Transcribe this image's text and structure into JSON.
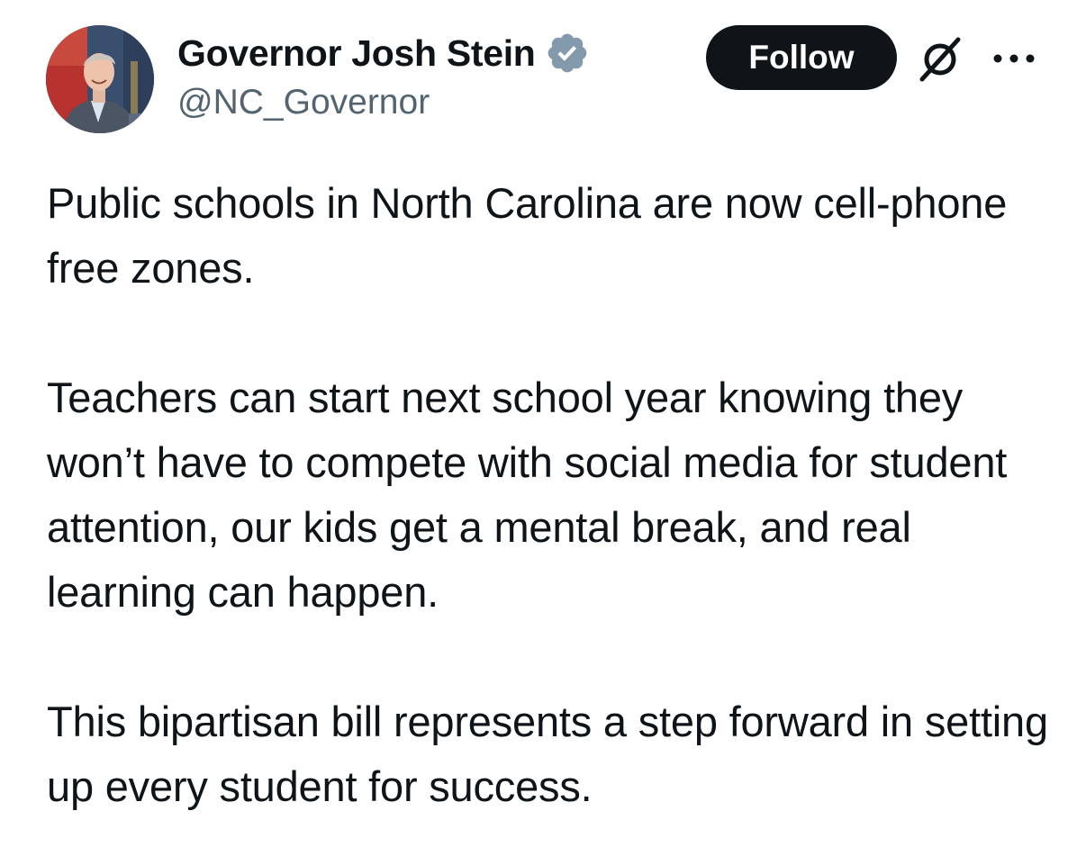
{
  "author": {
    "display_name": "Governor Josh Stein",
    "handle": "@NC_Governor",
    "verified_badge_color": "#829aab",
    "avatar_icon": "profile-photo"
  },
  "actions": {
    "follow_label": "Follow",
    "follow_bg_color": "#0f1419",
    "grok_icon": "grok-slash-icon",
    "more_icon": "more-horizontal-icon"
  },
  "tweet": {
    "paragraphs": [
      "Public schools in North Carolina are now cell-phone free zones.",
      "Teachers can start next school year knowing they won’t have to compete with social media for student attention, our kids get a mental break, and real learning can happen.",
      "This bipartisan bill represents a step forward in setting up every student for success."
    ]
  }
}
